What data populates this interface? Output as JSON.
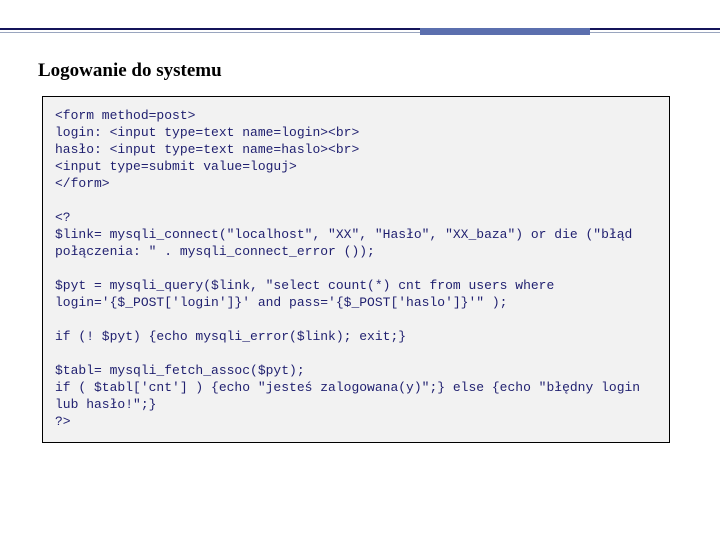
{
  "title": "Logowanie do systemu",
  "code": "<form method=post>\nlogin: <input type=text name=login><br>\nhasło: <input type=text name=haslo><br>\n<input type=submit value=loguj>\n</form>\n\n<?\n$link= mysqli_connect(\"localhost\", \"XX\", \"Hasło\", \"XX_baza\") or die (\"błąd połączenia: \" . mysqli_connect_error ());\n\n$pyt = mysqli_query($link, \"select count(*) cnt from users where login='{$_POST['login']}' and pass='{$_POST['haslo']}'\" );\n\nif (! $pyt) {echo mysqli_error($link); exit;}\n\n$tabl= mysqli_fetch_assoc($pyt);\nif ( $tabl['cnt'] ) {echo \"jesteś zalogowana(y)\";} else {echo \"błędny login lub hasło!\";}\n?>"
}
